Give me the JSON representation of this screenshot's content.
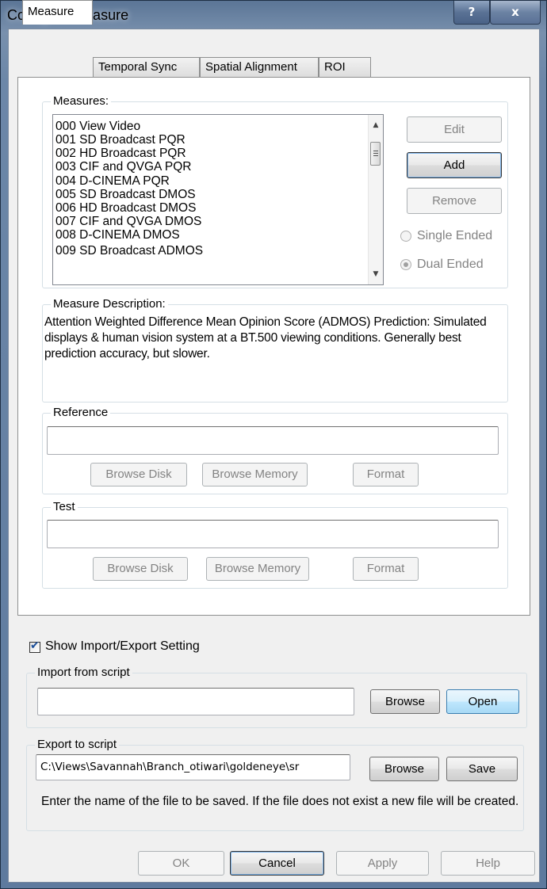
{
  "window": {
    "title": "Configure Measure",
    "help_label": "?",
    "close_label": "x"
  },
  "tabs": [
    "Measure",
    "Temporal Sync",
    "Spatial Alignment",
    "ROI"
  ],
  "measures": {
    "group_label": "Measures:",
    "items": [
      "000 View Video",
      "001 SD Broadcast PQR",
      "002 HD Broadcast PQR",
      "003 CIF and QVGA PQR",
      "004 D-CINEMA PQR",
      "005 SD Broadcast DMOS",
      "006 HD Broadcast DMOS",
      "007 CIF and QVGA DMOS",
      "008 D-CINEMA DMOS",
      "009 SD Broadcast ADMOS"
    ],
    "edit_label": "Edit",
    "add_label": "Add",
    "remove_label": "Remove",
    "single_ended_label": "Single Ended",
    "dual_ended_label": "Dual Ended",
    "selected_mode": "Dual Ended"
  },
  "description": {
    "group_label": "Measure Description:",
    "text": "Attention Weighted Difference Mean Opinion Score (ADMOS) Prediction: Simulated displays & human vision system at a BT.500 viewing conditions. Generally best prediction accuracy, but slower."
  },
  "reference": {
    "group_label": "Reference",
    "value": "",
    "browse_disk_label": "Browse Disk",
    "browse_memory_label": "Browse Memory",
    "format_label": "Format"
  },
  "test": {
    "group_label": "Test",
    "value": "",
    "browse_disk_label": "Browse Disk",
    "browse_memory_label": "Browse Memory",
    "format_label": "Format"
  },
  "show_import_export": {
    "label": "Show Import/Export Setting",
    "checked": true
  },
  "import": {
    "group_label": "Import from script",
    "value": "",
    "browse_label": "Browse",
    "open_label": "Open"
  },
  "export": {
    "group_label": "Export to script",
    "value": "C:\\Views\\Savannah\\Branch_otiwari\\goldeneye\\sr",
    "browse_label": "Browse",
    "save_label": "Save",
    "note": "Enter the name of the file to be saved. If the file does not exist a new file will be created."
  },
  "footer": {
    "ok_label": "OK",
    "cancel_label": "Cancel",
    "apply_label": "Apply",
    "help_label": "Help"
  }
}
